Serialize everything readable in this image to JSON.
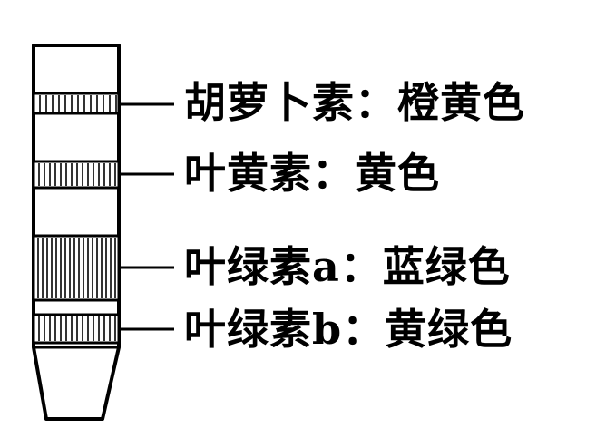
{
  "labels": {
    "carotene": "胡萝卜素：橙黄色",
    "xanthophyll": "叶黄素：黄色",
    "chlorophyll_a": "叶绿素a：蓝绿色",
    "chlorophyll_b": "叶绿素b：黄绿色"
  },
  "colors": {
    "ink": "#000000",
    "paper": "#ffffff"
  }
}
